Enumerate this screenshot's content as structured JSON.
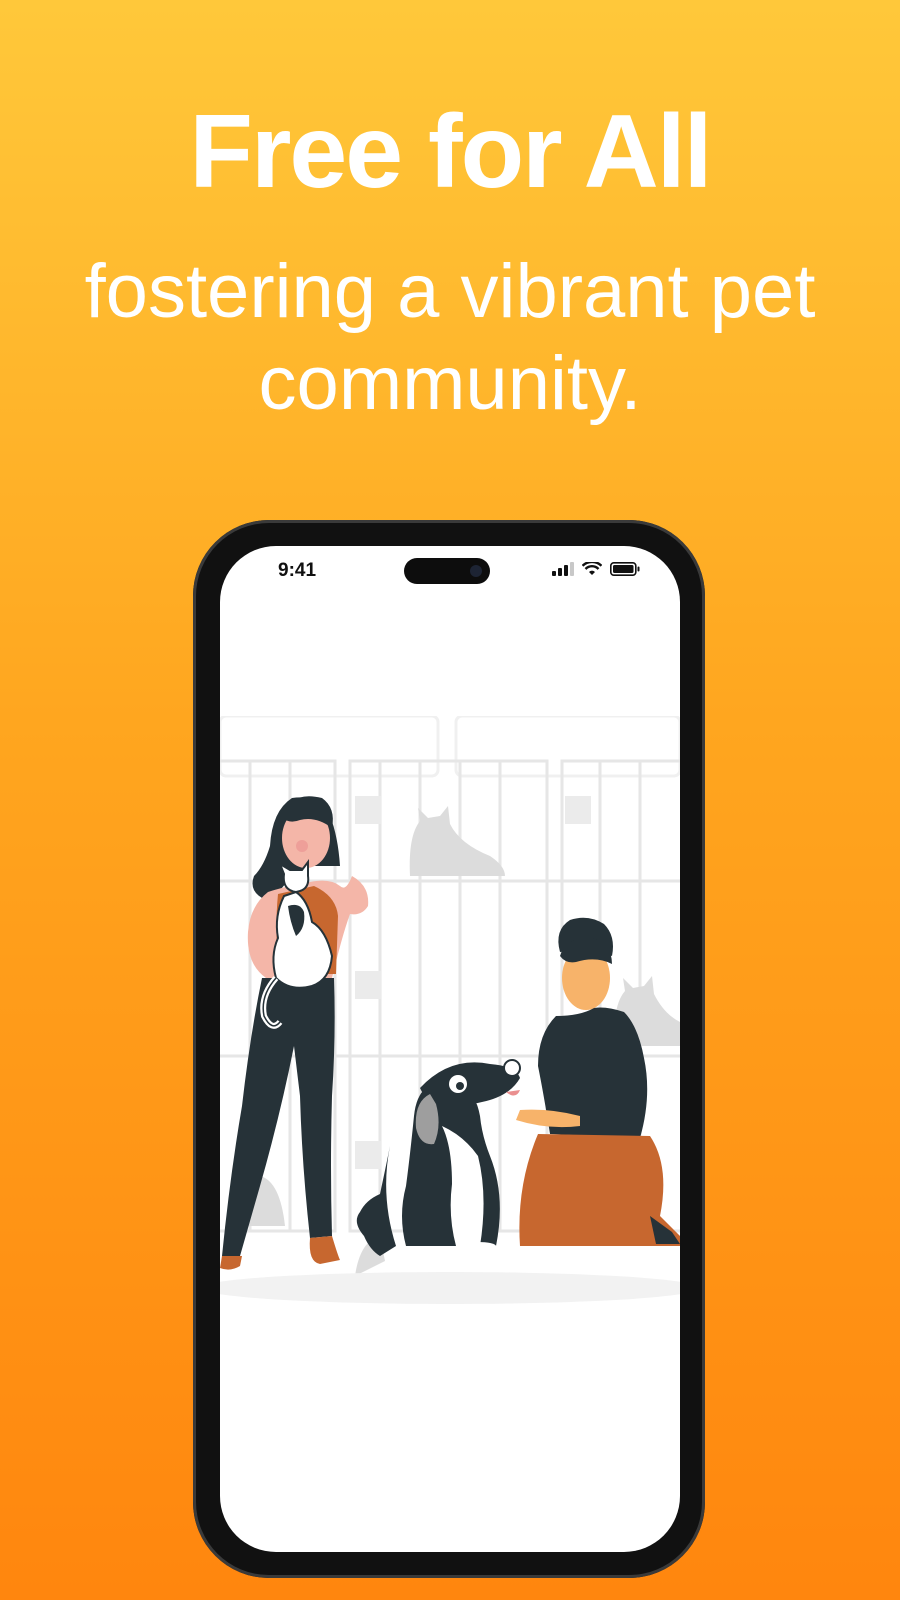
{
  "headline": "Free for All",
  "subline": "fostering a vibrant pet community.",
  "phone": {
    "time": "9:41",
    "icons": [
      "signal-icon",
      "wifi-icon",
      "battery-icon"
    ]
  },
  "illustration": "pet-shelter-illustration",
  "colors": {
    "gradient_top": "#FFC83A",
    "gradient_bottom": "#FF860E",
    "accent_orange": "#C7672F",
    "dark": "#263238"
  }
}
